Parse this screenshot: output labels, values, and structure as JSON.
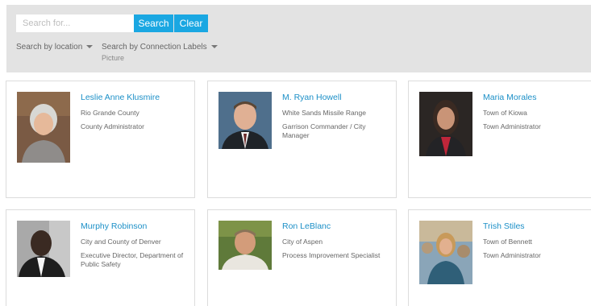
{
  "search": {
    "placeholder": "Search for...",
    "search_label": "Search",
    "clear_label": "Clear",
    "filter_location": "Search by location",
    "filter_labels": "Search by Connection Labels",
    "filter_labels_sub": "Picture"
  },
  "colors": {
    "accent": "#1aa7e2",
    "name_link": "#1b8fc7",
    "panel_bg": "#e3e3e3"
  },
  "people": [
    {
      "name": "Leslie Anne Klusmire",
      "org": "Rio Grande County",
      "title": "County Administrator"
    },
    {
      "name": "M. Ryan Howell",
      "org": "White Sands Missile Range",
      "title": "Garrison Commander / City Manager"
    },
    {
      "name": "Maria Morales",
      "org": "Town of Kiowa",
      "title": "Town Administrator"
    },
    {
      "name": "Murphy Robinson",
      "org": "City and County of Denver",
      "title": "Executive Director, Department of Public Safety"
    },
    {
      "name": "Ron LeBlanc",
      "org": "City of Aspen",
      "title": "Process Improvement Specialist"
    },
    {
      "name": "Trish Stiles",
      "org": "Town of Bennett",
      "title": "Town Administrator"
    }
  ]
}
